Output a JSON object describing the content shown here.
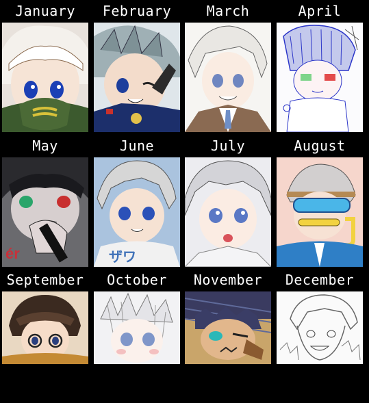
{
  "months": [
    {
      "label": "January"
    },
    {
      "label": "February"
    },
    {
      "label": "March"
    },
    {
      "label": "April"
    },
    {
      "label": "May"
    },
    {
      "label": "June"
    },
    {
      "label": "July"
    },
    {
      "label": "August"
    },
    {
      "label": "September"
    },
    {
      "label": "October"
    },
    {
      "label": "November"
    },
    {
      "label": "December"
    }
  ]
}
